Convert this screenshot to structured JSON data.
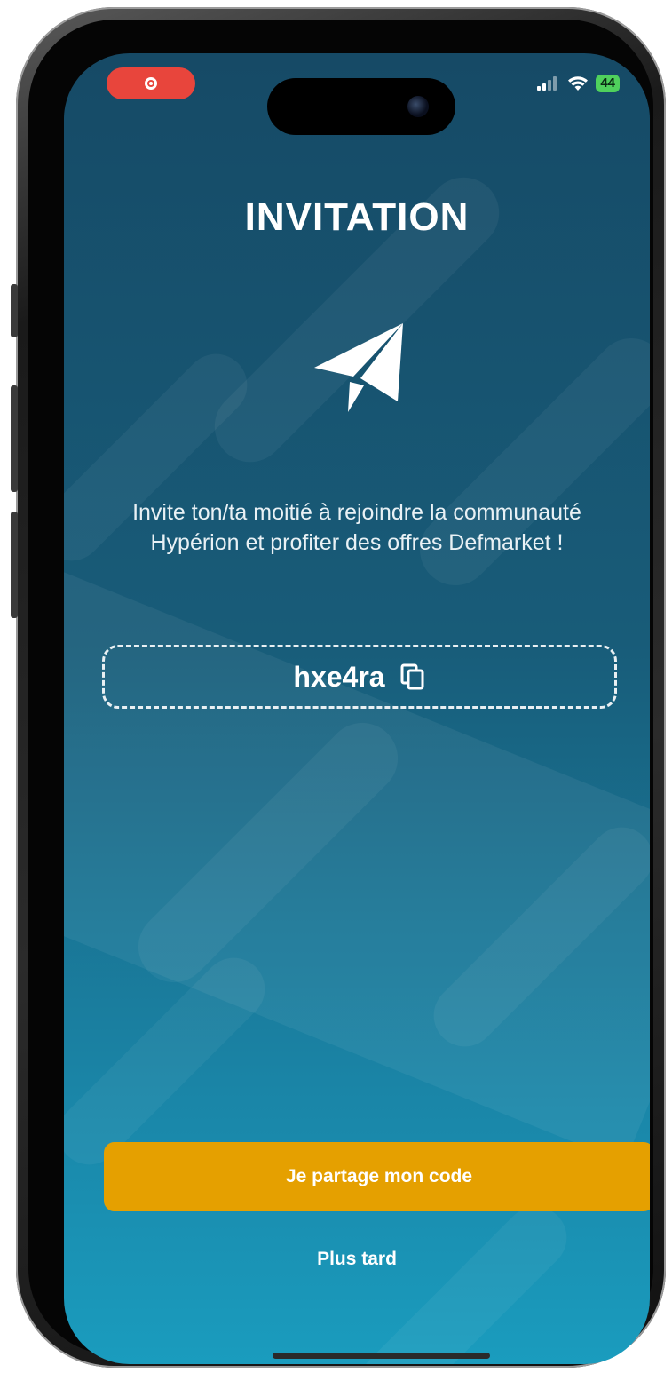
{
  "status_bar": {
    "recording_icon": "record-icon",
    "battery_level": "44",
    "signal_icon": "cellular-signal-icon",
    "wifi_icon": "wifi-icon"
  },
  "invitation": {
    "title": "INVITATION",
    "icon": "paper-plane-icon",
    "description_line1": "Invite ton/ta moitié à rejoindre la communauté",
    "description_line2": "Hypérion et profiter des offres Defmarket !",
    "code": "hxe4ra",
    "copy_icon": "copy-icon"
  },
  "actions": {
    "share_label": "Je partage mon code",
    "later_label": "Plus tard"
  },
  "colors": {
    "accent": "#e5a000",
    "background_top": "#164a66",
    "background_bottom": "#1a9cbe",
    "recording": "#e8453c",
    "battery": "#4fd15c"
  }
}
